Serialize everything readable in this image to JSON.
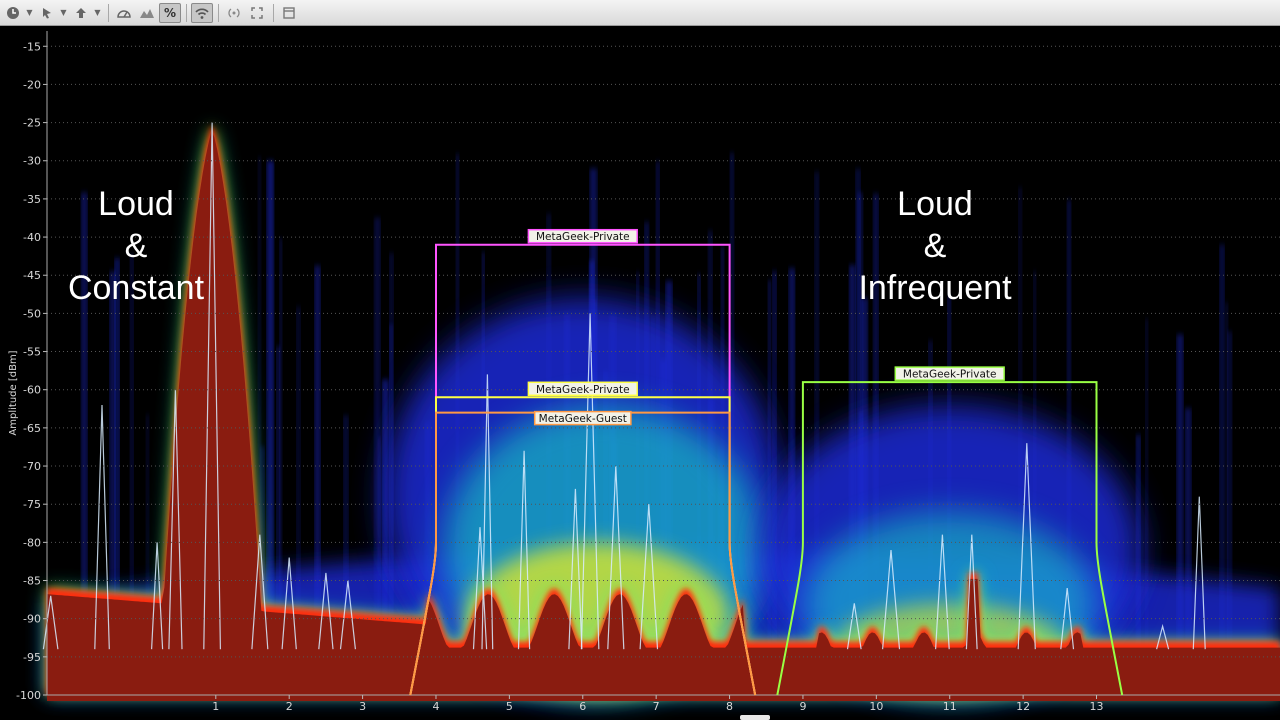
{
  "toolbar": {
    "buttons": [
      {
        "icon": "clock-icon"
      },
      {
        "icon": "cursor-icon"
      },
      {
        "icon": "upload-icon"
      },
      {
        "icon": "gauge-icon"
      },
      {
        "icon": "waterfall-icon"
      },
      {
        "icon": "percent-icon",
        "text": "%"
      },
      {
        "icon": "wifi-icon"
      },
      {
        "icon": "broadcast-icon"
      },
      {
        "icon": "fullscreen-icon"
      },
      {
        "icon": "window-icon"
      }
    ]
  },
  "annotations": {
    "left": [
      "Loud",
      "&",
      "Constant"
    ],
    "right": [
      "Loud",
      "&",
      "Infrequent"
    ]
  },
  "chart_data": {
    "type": "area",
    "ylabel": "Amplitude [dBm]",
    "xlabel": "",
    "ylim": [
      -100,
      -13
    ],
    "yticks": [
      -15,
      -20,
      -25,
      -30,
      -35,
      -40,
      -45,
      -50,
      -55,
      -60,
      -65,
      -70,
      -75,
      -80,
      -85,
      -90,
      -95,
      -100
    ],
    "xlim": [
      -1.3,
      15.5
    ],
    "xticks": [
      1,
      2,
      3,
      4,
      5,
      6,
      7,
      8,
      9,
      10,
      11,
      12,
      13
    ],
    "grid": true,
    "networks": [
      {
        "name": "MetaGeek-Private",
        "center": 6,
        "width": 4,
        "amplitude": -41,
        "color": "#ff55ff"
      },
      {
        "name": "MetaGeek-Private",
        "center": 6,
        "width": 4,
        "amplitude": -61,
        "color": "#ffff44"
      },
      {
        "name": "MetaGeek-Guest",
        "center": 6,
        "width": 4,
        "amplitude": -63,
        "color": "#ff9944"
      },
      {
        "name": "MetaGeek-Private",
        "center": 11,
        "width": 4,
        "amplitude": -59,
        "color": "#99ff44"
      }
    ],
    "constant_source": {
      "peak_channel": 0.95,
      "peak_dbm": -25,
      "base_dbm": -85
    },
    "colors": {
      "background": "#000000",
      "density_low": "#1a2cd6",
      "density_mid": "#19e6c6",
      "density_high": "#e6ee1a",
      "current_fill": "#8a1c10",
      "current_edge": "#ff2a10",
      "peak_trace": "#d8ecff",
      "grid": "#555555"
    }
  }
}
